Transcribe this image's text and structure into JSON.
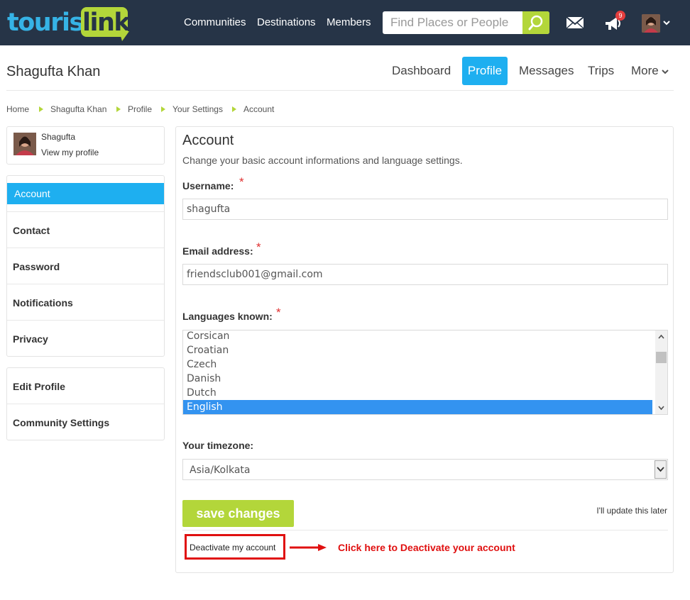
{
  "brand": {
    "logo_part1": "tourist",
    "logo_part2": "link"
  },
  "topnav": {
    "items": [
      "Communities",
      "Destinations",
      "Members"
    ],
    "search_placeholder": "Find Places or People",
    "notification_count": "9",
    "icons": [
      "search-icon",
      "mail-icon",
      "megaphone-icon",
      "chevron-down-icon"
    ]
  },
  "profile": {
    "name": "Shagufta Khan",
    "tabs": [
      {
        "label": "Dashboard",
        "active": false
      },
      {
        "label": "Profile",
        "active": true
      },
      {
        "label": "Messages",
        "active": false
      },
      {
        "label": "Trips",
        "active": false
      },
      {
        "label": "More",
        "active": false
      }
    ]
  },
  "breadcrumb": [
    "Home",
    "Shagufta Khan",
    "Profile",
    "Your Settings",
    "Account"
  ],
  "sidebar": {
    "user_first_name": "Shagufta",
    "view_profile": "View my profile",
    "settings_items": [
      {
        "label": "Account",
        "active": true
      },
      {
        "label": "Contact",
        "active": false
      },
      {
        "label": "Password",
        "active": false
      },
      {
        "label": "Notifications",
        "active": false
      },
      {
        "label": "Privacy",
        "active": false
      }
    ],
    "profile_items": [
      {
        "label": "Edit Profile"
      },
      {
        "label": "Community Settings"
      }
    ]
  },
  "form": {
    "title": "Account",
    "subtitle": "Change your basic account informations and language settings.",
    "required_mark": "*",
    "username_label": "Username:",
    "username_value": "shagufta",
    "email_label": "Email address:",
    "email_value": "friendsclub001@gmail.com",
    "languages_label": "Languages known:",
    "languages_visible": [
      "Corsican",
      "Croatian",
      "Czech",
      "Danish",
      "Dutch",
      "English"
    ],
    "languages_selected": "English",
    "timezone_label": "Your timezone:",
    "timezone_value": "Asia/Kolkata",
    "save_label": "save changes",
    "later_label": "I'll update this later",
    "deactivate_label": "Deactivate my account"
  },
  "annotation": {
    "text": "Click here to Deactivate your account",
    "color": "#e01010"
  },
  "colors": {
    "navbar": "#263447",
    "accent_blue": "#1eaff0",
    "accent_green": "#b3d63a",
    "selection_blue": "#3393f0"
  }
}
